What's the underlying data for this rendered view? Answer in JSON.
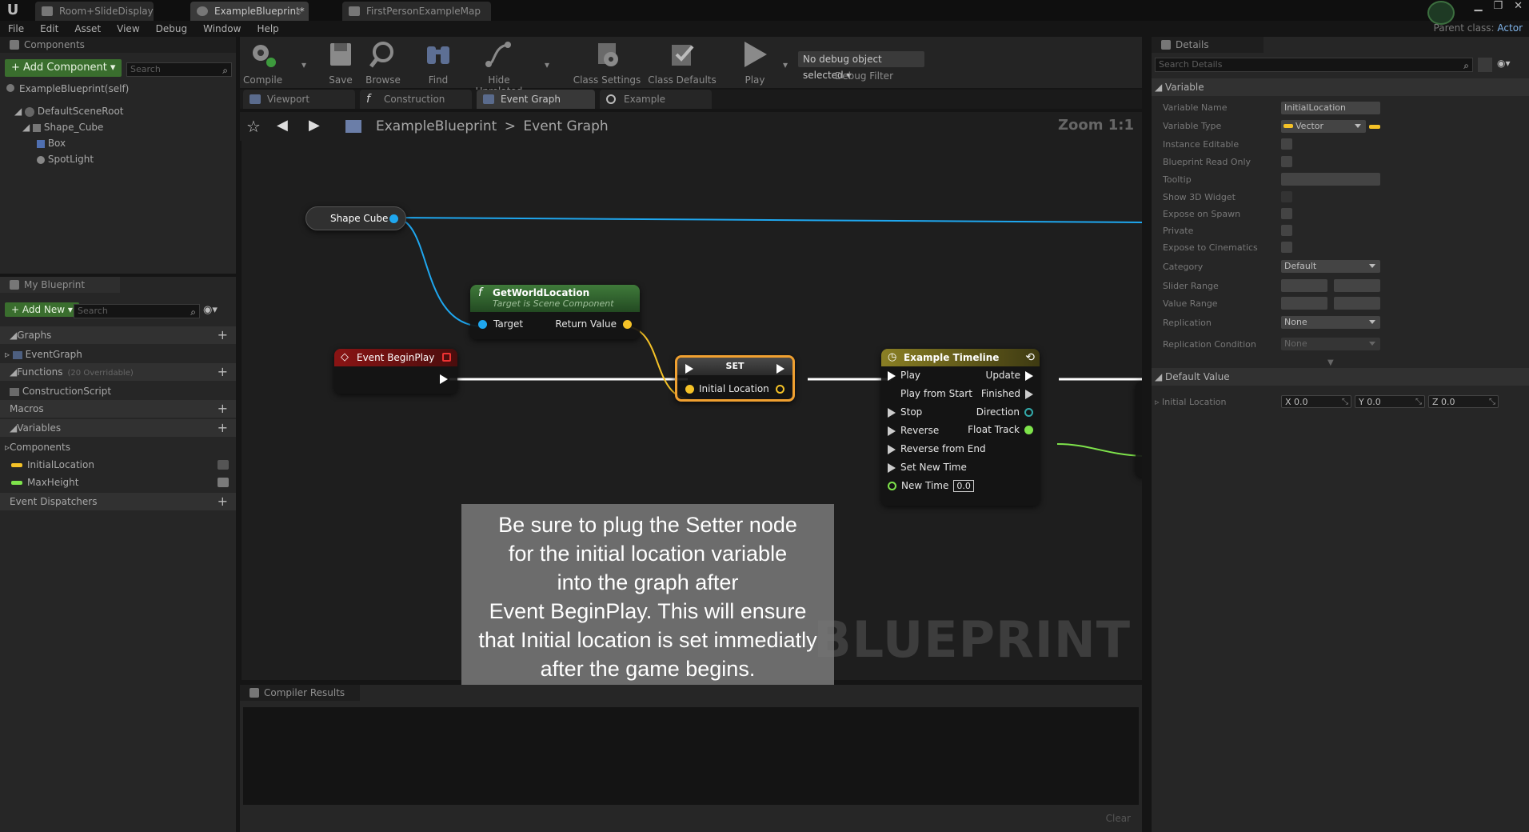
{
  "window": {
    "tabs": [
      {
        "label": "Room+SlideDisplay"
      },
      {
        "label": "ExampleBlueprint*"
      },
      {
        "label": "FirstPersonExampleMap"
      }
    ],
    "parent_class_label": "Parent class:",
    "parent_class_value": "Actor"
  },
  "menu": [
    "File",
    "Edit",
    "Asset",
    "View",
    "Debug",
    "Window",
    "Help"
  ],
  "components_panel": {
    "title": "Components",
    "add_button": "+ Add Component ▾",
    "search_placeholder": "Search",
    "self_item": "ExampleBlueprint(self)",
    "tree": [
      "DefaultSceneRoot",
      "Shape_Cube",
      "Box",
      "SpotLight"
    ]
  },
  "my_blueprint": {
    "title": "My Blueprint",
    "add_new": "+ Add New ▾",
    "search_placeholder": "Search",
    "sections": {
      "graphs": "Graphs",
      "event_graph": "EventGraph",
      "functions": "Functions",
      "functions_sub": "(20 Overridable)",
      "construction_script": "ConstructionScript",
      "macros": "Macros",
      "variables": "Variables",
      "components": "Components",
      "var1": "InitialLocation",
      "var2": "MaxHeight",
      "event_dispatchers": "Event Dispatchers"
    }
  },
  "toolbar": {
    "compile": "Compile",
    "save": "Save",
    "browse": "Browse",
    "find": "Find",
    "hide_unrelated": "Hide Unrelated",
    "class_settings": "Class Settings",
    "class_defaults": "Class Defaults",
    "play": "Play",
    "debug_select": "No debug object selected ▾",
    "debug_filter": "Debug Filter"
  },
  "editor_tabs": [
    "Viewport",
    "Construction Scrip",
    "Event Graph",
    "Example Timeline_"
  ],
  "breadcrumb": {
    "root": "ExampleBlueprint",
    "sep": ">",
    "current": "Event Graph",
    "zoom": "Zoom 1:1"
  },
  "graph": {
    "shape_cube": "Shape Cube",
    "get_world_location": {
      "title": "GetWorldLocation",
      "subtitle": "Target is Scene Component",
      "target": "Target",
      "return": "Return Value"
    },
    "begin_play": "Event BeginPlay",
    "set_node": {
      "title": "SET",
      "pin": "Initial Location"
    },
    "timeline": {
      "title": "Example Timeline",
      "inputs": [
        "Play",
        "Play from Start",
        "Stop",
        "Reverse",
        "Reverse from End",
        "Set New Time",
        "New Time"
      ],
      "outputs": [
        "Update",
        "Finished",
        "Direction",
        "Float Track"
      ],
      "new_time_value": "0.0"
    },
    "watermark": "BLUEPRINT"
  },
  "caption": {
    "lines": [
      "Be sure to plug the Setter node",
      "for the initial location variable",
      "into the graph after",
      "Event BeginPlay. This will ensure",
      "that Initial location is set immediatly",
      "after the game begins."
    ]
  },
  "compiler": {
    "title": "Compiler Results",
    "clear": "Clear"
  },
  "details": {
    "title": "Details",
    "search_placeholder": "Search Details",
    "variable_section": "Variable",
    "rows": {
      "variable_name": "Variable Name",
      "variable_name_value": "InitialLocation",
      "variable_type": "Variable Type",
      "variable_type_value": "Vector",
      "instance_editable": "Instance Editable",
      "blueprint_read_only": "Blueprint Read Only",
      "tooltip": "Tooltip",
      "show_3d_widget": "Show 3D Widget",
      "expose_on_spawn": "Expose on Spawn",
      "private": "Private",
      "expose_to_cinematics": "Expose to Cinematics",
      "category": "Category",
      "category_value": "Default",
      "slider_range": "Slider Range",
      "value_range": "Value Range",
      "replication": "Replication",
      "replication_value": "None",
      "replication_condition": "Replication Condition",
      "replication_condition_value": "None"
    },
    "default_value_section": "Default Value",
    "initial_location": "Initial Location",
    "x": "X  0.0",
    "y": "Y  0.0",
    "z": "Z  0.0"
  },
  "colors": {
    "vector_pin": "#f5c227",
    "object_pin": "#1fa7ef",
    "float_pin": "#7ee34b",
    "event_head": "#7a1111",
    "function_head": "#2f5a2e",
    "timeline_head": "#716a1f",
    "set_border": "#f0a030"
  }
}
